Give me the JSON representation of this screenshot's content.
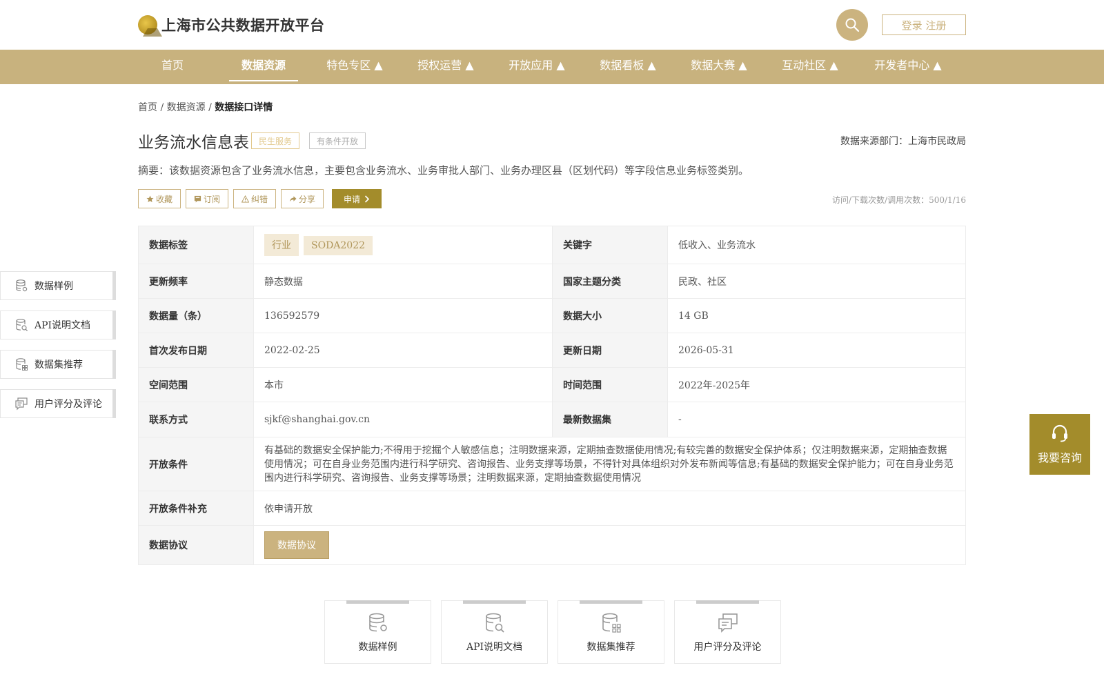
{
  "header": {
    "logo_text": "上海市公共数据开放平台",
    "login_label": "登录 注册"
  },
  "nav": [
    {
      "label": "首页"
    },
    {
      "label": "数据资源",
      "active": true
    },
    {
      "label": "特色专区 ▲"
    },
    {
      "label": "授权运营 ▲"
    },
    {
      "label": "开放应用 ▲"
    },
    {
      "label": "数据看板 ▲"
    },
    {
      "label": "数据大赛 ▲"
    },
    {
      "label": "互动社区 ▲"
    },
    {
      "label": "开发者中心 ▲"
    }
  ],
  "breadcrumb": {
    "home": "首页",
    "sep": "/",
    "resource": "数据资源",
    "current": "数据接口详情"
  },
  "dataset": {
    "title": "业务流水信息表",
    "tag_service": "民生服务",
    "tag_open": "有条件开放",
    "dept": "数据来源部门：上海市民政局",
    "summary": "摘要：该数据资源包含了业务流水信息，主要包含业务流水、业务审批人部门、业务办理区县（区划代码）等字段信息业务标签类别。",
    "stats": "访问/下载次数/调用次数：500/1/16"
  },
  "actions": {
    "collect": "收藏",
    "subscribe": "订阅",
    "error": "纠错",
    "share": "分享",
    "apply": "申请"
  },
  "table": {
    "label_tags": "数据标签",
    "tags": [
      "行业",
      "SODA2022"
    ],
    "label_keywords": "关键字",
    "keywords": "低收入、业务流水",
    "label_freq": "更新频率",
    "freq": "静态数据",
    "label_theme": "国家主题分类",
    "theme": "民政、社区",
    "label_count": "数据量（条）",
    "count": "136592579",
    "label_size": "数据大小",
    "size": "14 GB",
    "label_first_pub": "首次发布日期",
    "first_pub": "2022-02-25",
    "label_update": "更新日期",
    "update": "2026-05-31",
    "label_space": "空间范围",
    "space": "本市",
    "label_time": "时间范围",
    "time": "2022年-2025年",
    "label_contact": "联系方式",
    "contact": "sjkf@shanghai.gov.cn",
    "label_latest": "最新数据集",
    "latest": "-",
    "label_condition": "开放条件",
    "condition": "有基础的数据安全保护能力;不得用于挖掘个人敏感信息；注明数据来源，定期抽查数据使用情况;有较完善的数据安全保护体系；仅注明数据来源，定期抽查数据使用情况；可在自身业务范围内进行科学研究、咨询报告、业务支撑等场景，不得针对具体组织对外发布新闻等信息;有基础的数据安全保护能力；可在自身业务范围内进行科学研究、咨询报告、业务支撑等场景；注明数据来源，定期抽查数据使用情况",
    "label_condition_extra": "开放条件补充",
    "condition_extra": "依申请开放",
    "label_protocol": "数据协议",
    "protocol_button": "数据协议"
  },
  "side_menu": [
    "数据样例",
    "API说明文档",
    "数据集推荐",
    "用户评分及评论"
  ],
  "consult": {
    "label": "我要咨询"
  },
  "bottom_cards": [
    "数据样例",
    "API说明文档",
    "数据集推荐",
    "用户评分及评论"
  ],
  "colors": {
    "brand": "#c8b27e",
    "accent": "#a38c2b",
    "pill_bg": "#f3ead7"
  }
}
